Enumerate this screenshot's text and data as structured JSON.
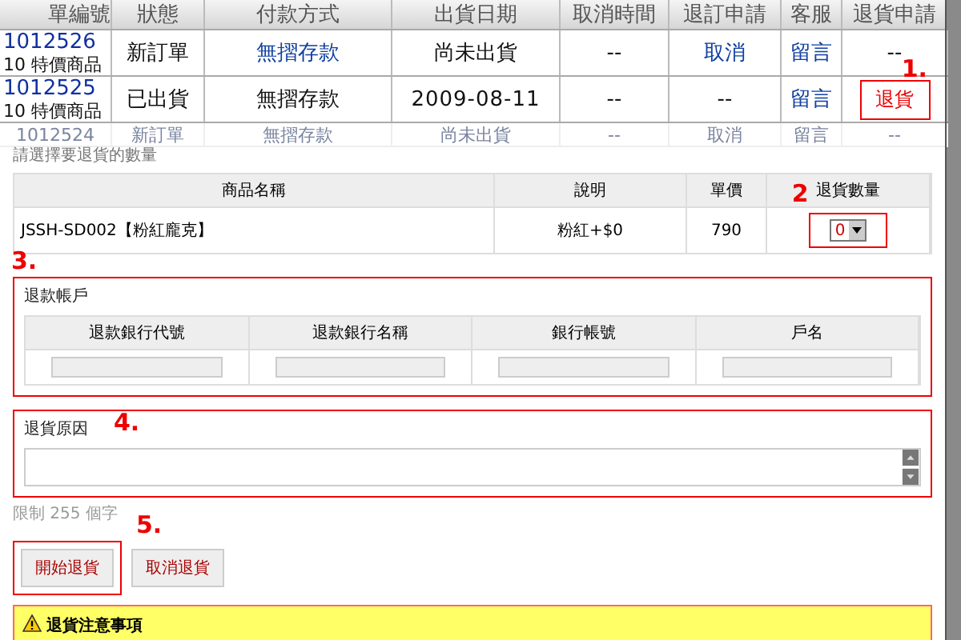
{
  "orders": {
    "columns": [
      "單編號",
      "狀態",
      "付款方式",
      "出貨日期",
      "取消時間",
      "退訂申請",
      "客服",
      "退貨申請"
    ],
    "rows": [
      {
        "faded": false,
        "cells": [
          {
            "kind": "order",
            "text": "1012526",
            "note": "10 特價商品"
          },
          {
            "kind": "text",
            "text": "新訂單"
          },
          {
            "kind": "link",
            "text": "無摺存款"
          },
          {
            "kind": "text",
            "text": "尚未出貨"
          },
          {
            "kind": "text",
            "text": "--"
          },
          {
            "kind": "link",
            "text": "取消"
          },
          {
            "kind": "link",
            "text": "留言"
          },
          {
            "kind": "text",
            "text": "--"
          }
        ]
      },
      {
        "faded": false,
        "cells": [
          {
            "kind": "order",
            "text": "1012525",
            "note": "10 特價商品"
          },
          {
            "kind": "text",
            "text": "已出貨"
          },
          {
            "kind": "text",
            "text": "無摺存款"
          },
          {
            "kind": "date",
            "text": "2009-08-11"
          },
          {
            "kind": "text",
            "text": "--"
          },
          {
            "kind": "text",
            "text": "--"
          },
          {
            "kind": "link",
            "text": "留言"
          },
          {
            "kind": "button",
            "text": "退貨",
            "callout": "1."
          }
        ]
      },
      {
        "faded": true,
        "cells": [
          {
            "kind": "text",
            "text": "1012524"
          },
          {
            "kind": "text",
            "text": "新訂單"
          },
          {
            "kind": "text",
            "text": "無摺存款"
          },
          {
            "kind": "text",
            "text": "尚未出貨"
          },
          {
            "kind": "text",
            "text": "--"
          },
          {
            "kind": "text",
            "text": "取消"
          },
          {
            "kind": "text",
            "text": "留言"
          },
          {
            "kind": "text",
            "text": "--"
          }
        ]
      }
    ]
  },
  "dialog": {
    "hint": "請選擇要退貨的數量",
    "items": {
      "columns": [
        "商品名稱",
        "說明",
        "單價",
        "退貨數量"
      ],
      "quantity_callout": "2",
      "rows": [
        {
          "name": "JSSH-SD002【粉紅龐克】",
          "spec": "粉紅+$0",
          "price": "790",
          "quantity": "0"
        }
      ]
    },
    "refund_account": {
      "title": "退款帳戶",
      "callout": "3.",
      "columns": [
        "退款銀行代號",
        "退款銀行名稱",
        "銀行帳號",
        "戶名"
      ]
    },
    "reason": {
      "title": "退貨原因",
      "callout": "4.",
      "limit": "限制 255 個字"
    },
    "buttons": [
      {
        "label": "開始退貨",
        "callout": "5."
      },
      {
        "label": "取消退貨"
      }
    ],
    "notice": {
      "title": "退貨注意事項"
    }
  }
}
